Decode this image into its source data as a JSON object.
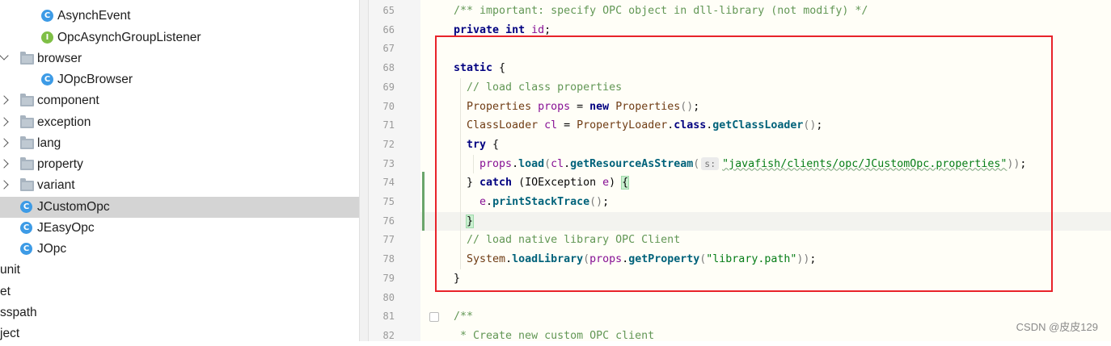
{
  "project_tree": {
    "rows": [
      {
        "label": "AsynchEvent",
        "icon": "class-icon",
        "selected": false
      },
      {
        "label": "OpcAsynchGroupListener",
        "icon": "interface-icon",
        "selected": false
      },
      {
        "label": "browser",
        "icon": "folder-icon",
        "expander": "expanded",
        "selected": false
      },
      {
        "label": "JOpcBrowser",
        "icon": "class-icon",
        "selected": false
      },
      {
        "label": "component",
        "icon": "folder-icon",
        "expander": "collapsed",
        "selected": false
      },
      {
        "label": "exception",
        "icon": "folder-icon",
        "expander": "collapsed",
        "selected": false
      },
      {
        "label": "lang",
        "icon": "folder-icon",
        "expander": "collapsed",
        "selected": false
      },
      {
        "label": "property",
        "icon": "folder-icon",
        "expander": "collapsed",
        "selected": false
      },
      {
        "label": "variant",
        "icon": "folder-icon",
        "expander": "collapsed",
        "selected": false
      },
      {
        "label": "JCustomOpc",
        "icon": "class-icon",
        "selected": true
      },
      {
        "label": "JEasyOpc",
        "icon": "class-icon",
        "selected": false
      },
      {
        "label": "JOpc",
        "icon": "class-icon",
        "selected": false
      },
      {
        "label": "unit",
        "icon": "",
        "selected": false
      },
      {
        "label": "et",
        "icon": "",
        "selected": false
      },
      {
        "label": "sspath",
        "icon": "",
        "selected": false
      },
      {
        "label": "ject",
        "icon": "",
        "selected": false
      }
    ]
  },
  "editor": {
    "line_numbers": [
      "65",
      "66",
      "67",
      "68",
      "69",
      "70",
      "71",
      "72",
      "73",
      "74",
      "75",
      "76",
      "77",
      "78",
      "79",
      "80",
      "81",
      "82"
    ],
    "current_line": "76",
    "lines": [
      [
        {
          "t": "/** important: specify OPC object in dll-library (not modify) */",
          "c": "cm-doc"
        }
      ],
      [
        {
          "t": "private",
          "c": "kw"
        },
        {
          "t": " "
        },
        {
          "t": "int",
          "c": "kw"
        },
        {
          "t": " "
        },
        {
          "t": "id",
          "c": "fld"
        },
        {
          "t": ";"
        }
      ],
      [],
      [
        {
          "t": "static",
          "c": "kw"
        },
        {
          "t": " {"
        }
      ],
      [
        {
          "t": "  "
        },
        {
          "t": "// load class properties",
          "c": "cm"
        }
      ],
      [
        {
          "t": "  "
        },
        {
          "t": "Properties",
          "c": "cls"
        },
        {
          "t": " "
        },
        {
          "t": "props",
          "c": "fld"
        },
        {
          "t": " = "
        },
        {
          "t": "new",
          "c": "kw"
        },
        {
          "t": " "
        },
        {
          "t": "Properties",
          "c": "cls"
        },
        {
          "t": "()",
          "c": "pn"
        },
        {
          "t": ";"
        }
      ],
      [
        {
          "t": "  "
        },
        {
          "t": "ClassLoader",
          "c": "cls"
        },
        {
          "t": " "
        },
        {
          "t": "cl",
          "c": "fld"
        },
        {
          "t": " = "
        },
        {
          "t": "PropertyLoader",
          "c": "cls"
        },
        {
          "t": "."
        },
        {
          "t": "class",
          "c": "kw"
        },
        {
          "t": "."
        },
        {
          "t": "getClassLoader",
          "c": "mth"
        },
        {
          "t": "()",
          "c": "pn"
        },
        {
          "t": ";"
        }
      ],
      [
        {
          "t": "  "
        },
        {
          "t": "try",
          "c": "kw"
        },
        {
          "t": " {"
        }
      ],
      [
        {
          "t": "    "
        },
        {
          "t": "props",
          "c": "fld"
        },
        {
          "t": "."
        },
        {
          "t": "load",
          "c": "mth"
        },
        {
          "t": "(",
          "c": "pn"
        },
        {
          "t": "cl",
          "c": "fld"
        },
        {
          "t": "."
        },
        {
          "t": "getResourceAsStream",
          "c": "mth"
        },
        {
          "t": "(",
          "c": "pn"
        },
        {
          "t": "s:",
          "c": "hint"
        },
        {
          "t": "\"javafish/clients/opc/JCustomOpc.properties\"",
          "c": "str-link"
        },
        {
          "t": "))",
          "c": "pn"
        },
        {
          "t": ";"
        }
      ],
      [
        {
          "t": "  } "
        },
        {
          "t": "catch",
          "c": "kw"
        },
        {
          "t": " (IOException "
        },
        {
          "t": "e",
          "c": "fld"
        },
        {
          "t": ") "
        },
        {
          "t": "{",
          "c": "brace-match"
        }
      ],
      [
        {
          "t": "    "
        },
        {
          "t": "e",
          "c": "fld"
        },
        {
          "t": "."
        },
        {
          "t": "printStackTrace",
          "c": "mth"
        },
        {
          "t": "()",
          "c": "pn"
        },
        {
          "t": ";"
        }
      ],
      [
        {
          "t": "  "
        },
        {
          "t": "}",
          "c": "brace-match"
        }
      ],
      [
        {
          "t": "  "
        },
        {
          "t": "// load native library OPC Client",
          "c": "cm"
        }
      ],
      [
        {
          "t": "  "
        },
        {
          "t": "System",
          "c": "cls"
        },
        {
          "t": "."
        },
        {
          "t": "loadLibrary",
          "c": "mth"
        },
        {
          "t": "(",
          "c": "pn"
        },
        {
          "t": "props",
          "c": "fld"
        },
        {
          "t": "."
        },
        {
          "t": "getProperty",
          "c": "mth"
        },
        {
          "t": "(",
          "c": "pn"
        },
        {
          "t": "\"library.path\"",
          "c": "str"
        },
        {
          "t": "))",
          "c": "pn"
        },
        {
          "t": ";"
        }
      ],
      [
        {
          "t": "}"
        }
      ],
      [],
      [
        {
          "t": "/**",
          "c": "cm-doc"
        }
      ],
      [
        {
          "t": " * Create new custom OPC client",
          "c": "cm-doc"
        }
      ]
    ]
  },
  "watermark": "CSDN @皮皮129",
  "annotation_color": "#e8232a"
}
